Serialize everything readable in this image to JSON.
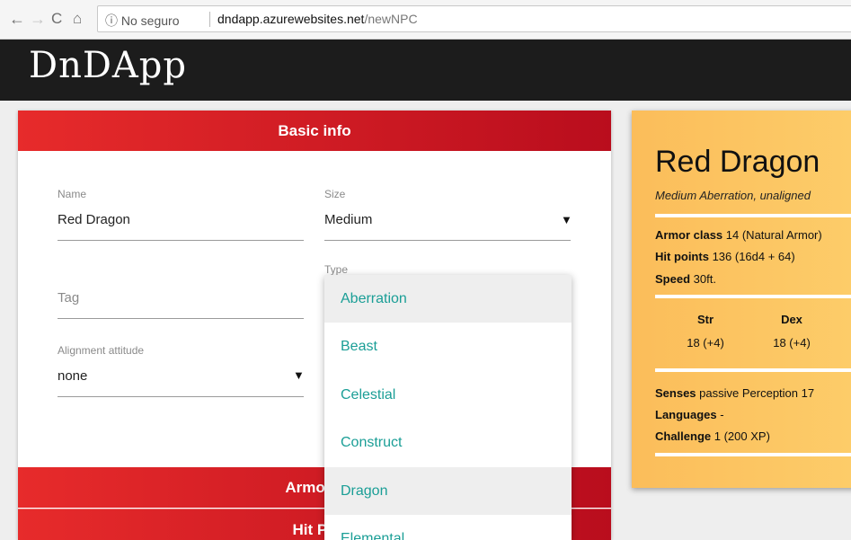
{
  "browser": {
    "info_label": "ⓘ No seguro",
    "url_host": "dndapp.azurewebsites.net",
    "url_path": "/newNPC"
  },
  "app": {
    "title": "DnDApp"
  },
  "form": {
    "basic_info_title": "Basic info",
    "name": {
      "label": "Name",
      "value": "Red Dragon"
    },
    "size": {
      "label": "Size",
      "value": "Medium"
    },
    "type": {
      "label": "Type"
    },
    "tag": {
      "placeholder": "Tag"
    },
    "alignment": {
      "label": "Alignment attitude",
      "value": "none"
    },
    "armor_title": "Armor c",
    "hp_title": "Hit Po"
  },
  "type_dropdown": {
    "options": [
      "Aberration",
      "Beast",
      "Celestial",
      "Construct",
      "Dragon",
      "Elemental"
    ],
    "highlighted": [
      "Aberration",
      "Dragon"
    ]
  },
  "stat_block": {
    "name": "Red Dragon",
    "subtitle": "Medium Aberration, unaligned",
    "armor_class_label": "Armor class",
    "armor_class_value": "14 (Natural Armor)",
    "hit_points_label": "Hit points",
    "hit_points_value": "136 (16d4 + 64)",
    "speed_label": "Speed",
    "speed_value": "30ft.",
    "abilities": [
      {
        "name": "Str",
        "value": "18 (+4)"
      },
      {
        "name": "Dex",
        "value": "18 (+4)"
      }
    ],
    "senses_label": "Senses",
    "senses_value": "passive Perception 17",
    "languages_label": "Languages",
    "languages_value": "-",
    "challenge_label": "Challenge",
    "challenge_value": "1 (200 XP)"
  },
  "colors": {
    "section_header_start": "#e72b2b",
    "section_header_end": "#b90d1d",
    "dropdown_text": "#1a9e96",
    "stat_block_bg": "#fdc462",
    "app_bar": "#1c1c1c"
  }
}
